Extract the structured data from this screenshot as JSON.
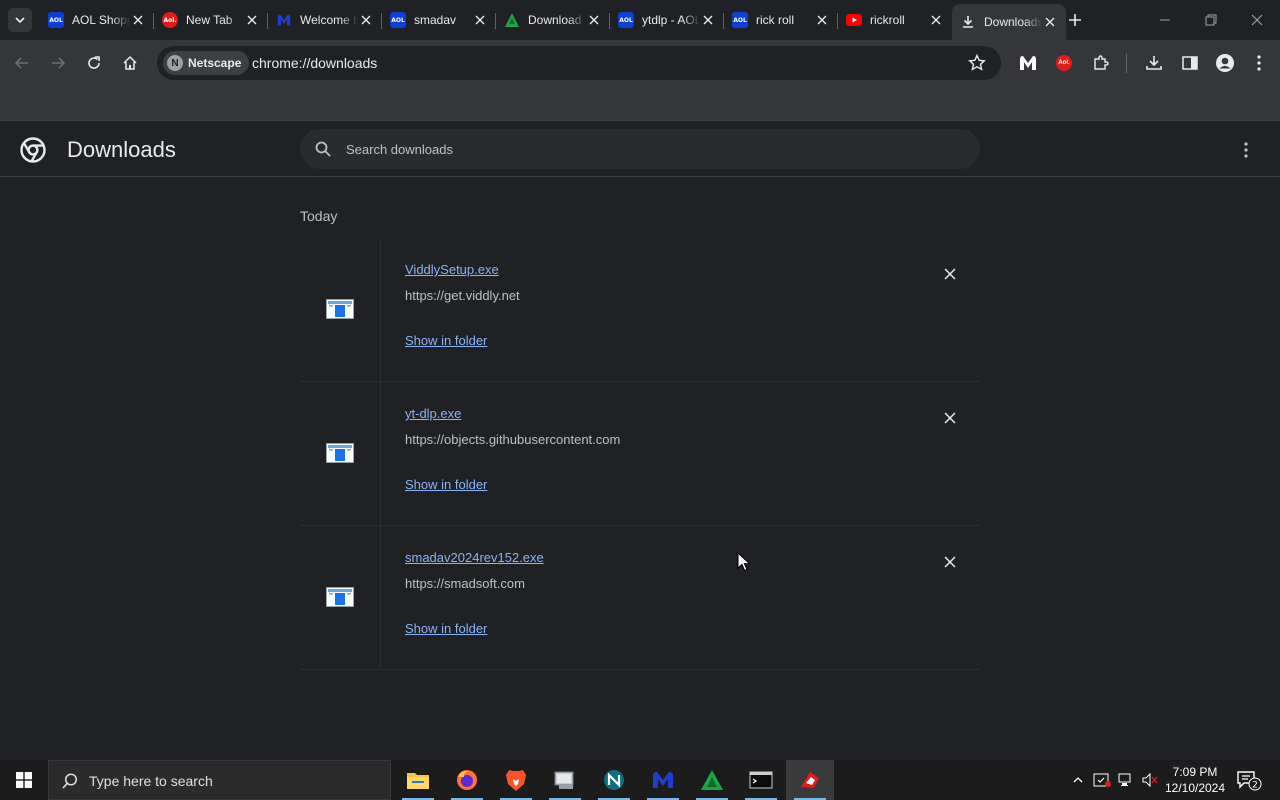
{
  "tabs": [
    {
      "title": "AOL Shopping",
      "fav_text": "AOL",
      "fav_color": "#0b3fd6"
    },
    {
      "title": "New Tab",
      "fav_text": "Aol.",
      "fav_color": "#e21b1b",
      "fav_round": true
    },
    {
      "title": "Welcome to Malwarebytes",
      "fav_text": "M",
      "fav_color": "#1f3ecf",
      "malware": true
    },
    {
      "title": "smadav",
      "fav_text": "AOL",
      "fav_color": "#0b3fd6"
    },
    {
      "title": "Download",
      "fav_text": "",
      "fav_color": "#1ea446",
      "triangle": true
    },
    {
      "title": "ytdlp - AOL",
      "fav_text": "AOL",
      "fav_color": "#0b3fd6"
    },
    {
      "title": "rick roll",
      "fav_text": "AOL",
      "fav_color": "#0b3fd6"
    },
    {
      "title": "rickroll",
      "fav_text": "",
      "fav_color": "#ff0000",
      "youtube": true
    },
    {
      "title": "Downloads",
      "fav_text": "",
      "fav_color": "",
      "download": true,
      "active": true
    }
  ],
  "toolbar": {
    "site_chip": "Netscape",
    "url": "chrome://downloads"
  },
  "page": {
    "title": "Downloads",
    "search_placeholder": "Search downloads",
    "date_header": "Today"
  },
  "downloads": [
    {
      "filename": "ViddlySetup.exe",
      "source": "https://get.viddly.net",
      "action": "Show in folder"
    },
    {
      "filename": "yt-dlp.exe",
      "source": "https://objects.githubusercontent.com",
      "action": "Show in folder"
    },
    {
      "filename": "smadav2024rev152.exe",
      "source": "https://smadsoft.com",
      "action": "Show in folder"
    }
  ],
  "taskbar": {
    "search_placeholder": "Type here to search",
    "time": "7:09 PM",
    "date": "12/10/2024",
    "notifications": "2"
  }
}
